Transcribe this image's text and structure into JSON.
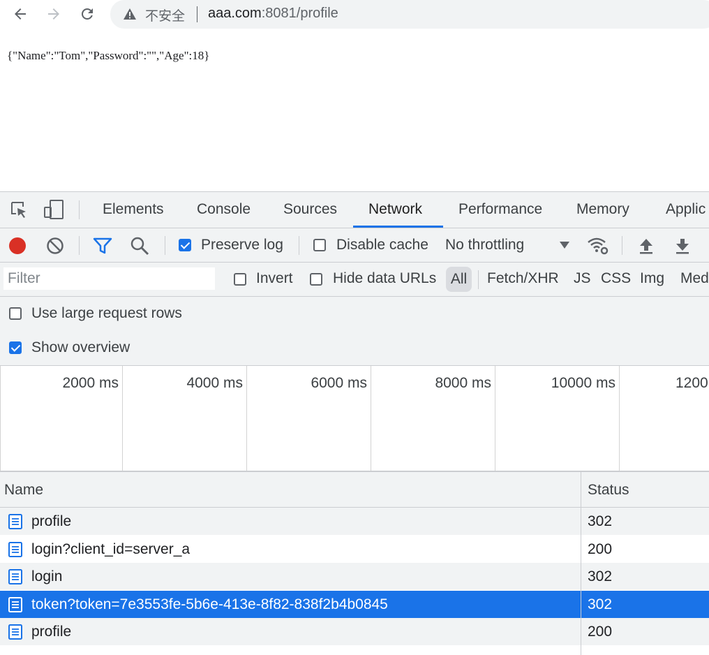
{
  "browser": {
    "security_label": "不安全",
    "url_host": "aaa.com",
    "url_rest": ":8081/profile"
  },
  "page": {
    "body_text": "{\"Name\":\"Tom\",\"Password\":\"\",\"Age\":18}"
  },
  "devtools": {
    "tabs": [
      "Elements",
      "Console",
      "Sources",
      "Network",
      "Performance",
      "Memory",
      "Applic"
    ],
    "active_tab": "Network",
    "toolbar": {
      "preserve_log_label": "Preserve log",
      "preserve_log_checked": true,
      "disable_cache_label": "Disable cache",
      "disable_cache_checked": false,
      "throttling_value": "No throttling"
    },
    "filter": {
      "placeholder": "Filter",
      "invert_label": "Invert",
      "hide_data_urls_label": "Hide data URLs",
      "types": [
        "All",
        "Fetch/XHR",
        "JS",
        "CSS",
        "Img",
        "Med"
      ],
      "active_type": "All"
    },
    "settings": {
      "large_rows_label": "Use large request rows",
      "large_rows_checked": false,
      "show_overview_label": "Show overview",
      "show_overview_checked": true
    },
    "overview": {
      "ticks": [
        "2000 ms",
        "4000 ms",
        "6000 ms",
        "8000 ms",
        "10000 ms",
        "1200"
      ]
    },
    "requests": {
      "columns": [
        "Name",
        "Status"
      ],
      "rows": [
        {
          "name": "profile",
          "status": "302"
        },
        {
          "name": "login?client_id=server_a",
          "status": "200"
        },
        {
          "name": "login",
          "status": "302"
        },
        {
          "name": "token?token=7e3553fe-5b6e-413e-8f82-838f2b4b0845",
          "status": "302"
        },
        {
          "name": "profile",
          "status": "200"
        }
      ],
      "selected_index": 3
    }
  },
  "colors": {
    "accent": "#1a73e8",
    "record": "#d93025",
    "toolbar_bg": "#f1f3f4"
  }
}
